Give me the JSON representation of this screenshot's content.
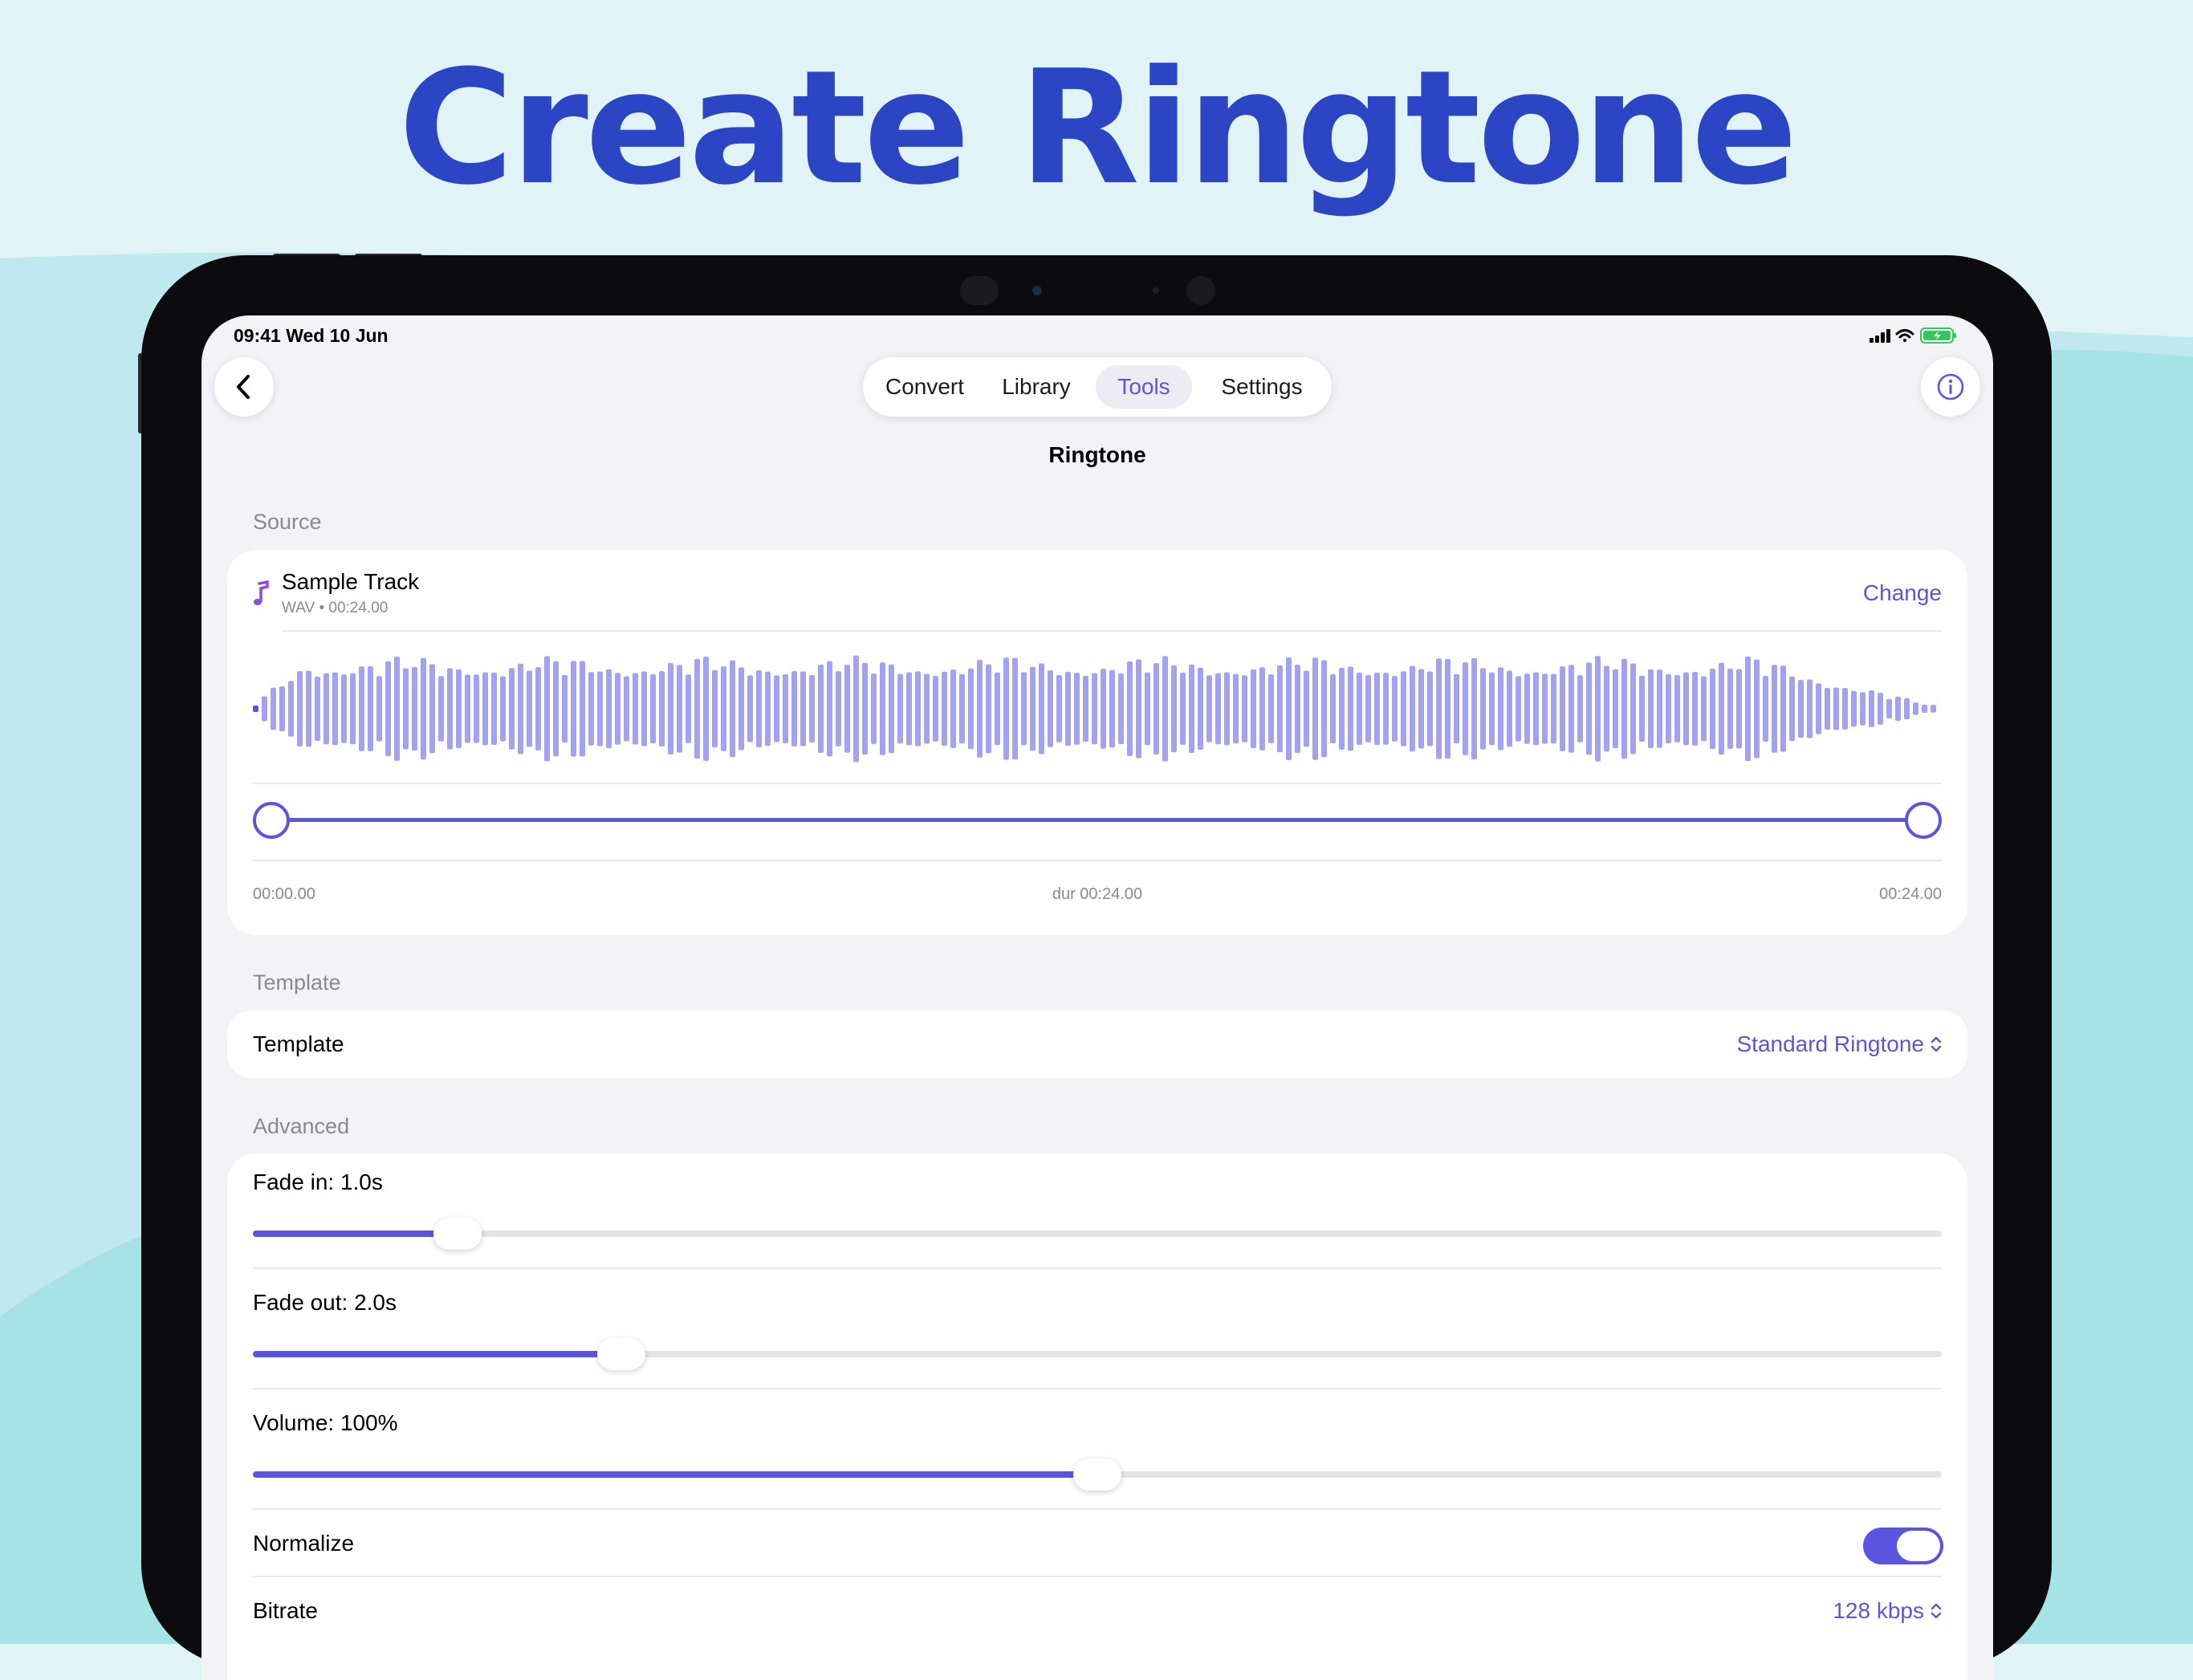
{
  "headline": "Create Ringtone",
  "status": {
    "time_date": "09:41  Wed 10 Jun"
  },
  "tabs": [
    {
      "label": "Convert"
    },
    {
      "label": "Library"
    },
    {
      "label": "Tools"
    },
    {
      "label": "Settings"
    }
  ],
  "active_tab": "Tools",
  "nav_title": "Ringtone",
  "source": {
    "section_label": "Source",
    "track_name": "Sample Track",
    "track_meta": "WAV • 00:24.00",
    "change_label": "Change",
    "start_time": "00:00.00",
    "duration": "dur 00:24.00",
    "end_time": "00:24.00",
    "trim_start_fraction": 0.0,
    "trim_end_fraction": 1.0
  },
  "template": {
    "section_label": "Template",
    "row_label": "Template",
    "value": "Standard Ringtone"
  },
  "advanced": {
    "section_label": "Advanced",
    "fade_in_label": "Fade in: 1.0s",
    "fade_in_fraction": 0.11,
    "fade_out_label": "Fade out: 2.0s",
    "fade_out_fraction": 0.21,
    "volume_label": "Volume: 100%",
    "volume_fraction": 0.5,
    "normalize_label": "Normalize",
    "normalize_on": true,
    "bitrate_label": "Bitrate",
    "bitrate_value": "128 kbps"
  },
  "icons": {
    "back": "chevron-left-icon",
    "info": "info-icon",
    "music": "music-note-icon",
    "updown": "chevron-up-down-icon"
  },
  "colors": {
    "accent": "#5a55e0",
    "waveform": "#a3a2f0",
    "headline": "#2b45c5",
    "background": "#e0f4f7",
    "battery": "#34c759"
  }
}
